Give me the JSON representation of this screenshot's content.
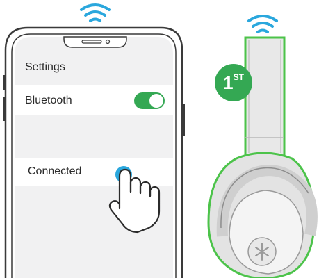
{
  "phone": {
    "settings_label": "Settings",
    "bluetooth_label": "Bluetooth",
    "bluetooth_toggle_on": true,
    "connected_label": "Connected"
  },
  "headphone": {
    "step_number": "1",
    "step_suffix": "ST"
  },
  "colors": {
    "wifi": "#2aa7dd",
    "toggle": "#34a853",
    "highlight": "#4cc34a",
    "tap": "#2aa7dd"
  },
  "icons": [
    "wifi-icon",
    "hand-pointer-icon",
    "logo-icon"
  ]
}
